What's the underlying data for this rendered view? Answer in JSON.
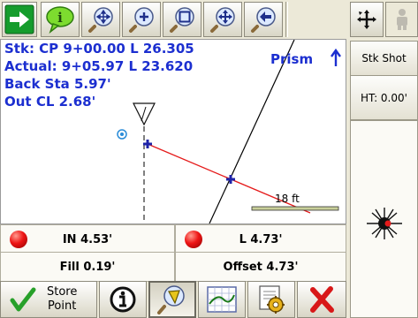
{
  "toolbar": {
    "icons": [
      "arrow-right-icon",
      "tip-icon",
      "zoom-extents-icon",
      "zoom-in-icon",
      "zoom-window-icon",
      "pan-icon",
      "previous-view-icon",
      "small-move-icon",
      "disabled-person-icon"
    ]
  },
  "plot": {
    "station_line": "Stk: CP 9+00.00 L 26.305",
    "actual_line": "Actual: 9+05.97 L 23.620",
    "back_sta": "Back Sta 5.97'",
    "out_cl": "Out CL 2.68'",
    "prism_label": "Prism",
    "scale_label": "18 ft"
  },
  "readouts": {
    "in": "IN 4.53'",
    "left": "L 4.73'",
    "fill": "Fill 0.19'",
    "offset": "Offset 4.73'"
  },
  "sidebar": {
    "stake_shot": "Stk Shot",
    "ht": "HT: 0.00'"
  },
  "bottom": {
    "store_point_line1": "Store",
    "store_point_line2": "Point"
  },
  "colors": {
    "accent_text": "#1c2fd0",
    "led": "#ee1515",
    "store_check": "#27a02a",
    "cancel": "#d81818",
    "line_red": "#e51b1b"
  }
}
